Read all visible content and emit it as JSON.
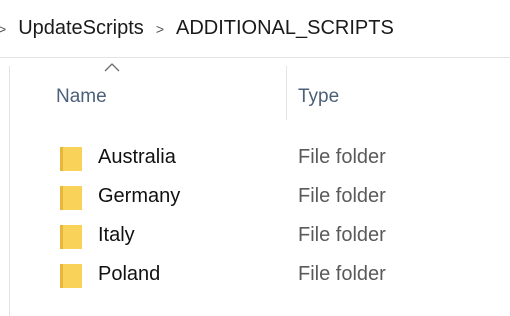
{
  "breadcrumb": {
    "items": [
      "UpdateScripts",
      "ADDITIONAL_SCRIPTS"
    ],
    "separator": ">"
  },
  "columns": {
    "name": "Name",
    "type": "Type",
    "sort_indicator_icon": "sort-ascending-icon"
  },
  "files": [
    {
      "name": "Australia",
      "type": "File folder"
    },
    {
      "name": "Germany",
      "type": "File folder"
    },
    {
      "name": "Italy",
      "type": "File folder"
    },
    {
      "name": "Poland",
      "type": "File folder"
    }
  ],
  "colors": {
    "folder": "#f9d25a",
    "folder_dark": "#e8b73a",
    "header_text": "#4c607a"
  }
}
